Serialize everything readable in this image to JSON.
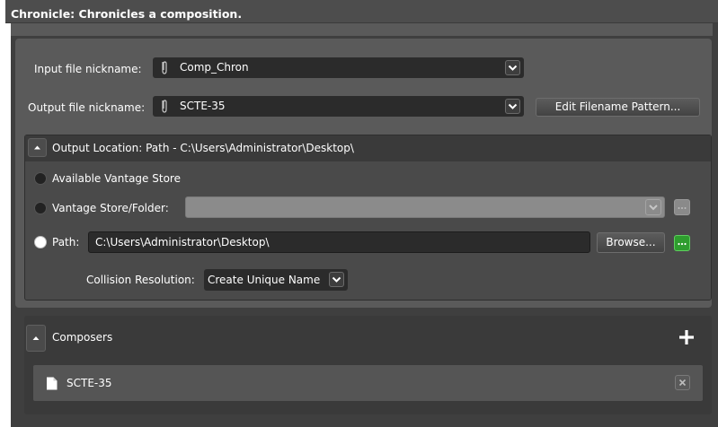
{
  "window": {
    "title": "Chronicle: Chronicles a composition."
  },
  "input": {
    "label": "Input file nickname:",
    "value": "Comp_Chron",
    "icon": "paperclip-icon"
  },
  "output": {
    "label": "Output file nickname:",
    "value": "SCTE-35",
    "icon": "paperclip-icon",
    "edit_button": "Edit Filename Pattern..."
  },
  "location": {
    "header": "Output Location: Path - C:\\Users\\Administrator\\Desktop\\",
    "option_store": "Available Vantage Store",
    "option_folder": "Vantage Store/Folder:",
    "folder_value": "",
    "option_path": "Path:",
    "path_value": "C:\\Users\\Administrator\\Desktop\\",
    "browse_button": "Browse...",
    "selected": "path",
    "collision_label": "Collision Resolution:",
    "collision_value": "Create Unique Name"
  },
  "composers": {
    "header": "Composers",
    "items": [
      {
        "label": "SCTE-35"
      }
    ]
  },
  "colors": {
    "dark_panel": "#3a3a3a",
    "field_bg": "#2b2b2b",
    "green_accent": "#2e9d2e"
  }
}
